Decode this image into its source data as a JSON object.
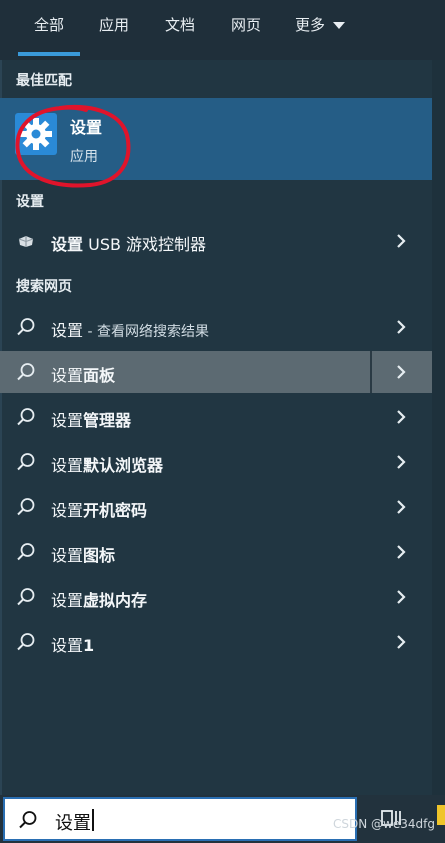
{
  "tabs": [
    {
      "label": "全部",
      "active": true
    },
    {
      "label": "应用",
      "active": false
    },
    {
      "label": "文档",
      "active": false
    },
    {
      "label": "网页",
      "active": false
    },
    {
      "label": "更多",
      "active": false
    }
  ],
  "best_match": {
    "section_label": "最佳匹配",
    "title": "设置",
    "subtitle": "应用",
    "icon": "gear-icon"
  },
  "settings_section": {
    "label": "设置",
    "items": [
      {
        "bold": "设置",
        "rest": " USB 游戏控制器",
        "icon": "gamepad-icon"
      }
    ]
  },
  "web_section": {
    "label": "搜索网页",
    "items": [
      {
        "prefix": "设置",
        "suffix": " - 查看网络搜索结果",
        "style": "muted"
      },
      {
        "prefix": "设置",
        "suffix": "面板",
        "style": "bold",
        "selected": true
      },
      {
        "prefix": "设置",
        "suffix": "管理器",
        "style": "bold"
      },
      {
        "prefix": "设置",
        "suffix": "默认浏览器",
        "style": "bold"
      },
      {
        "prefix": "设置",
        "suffix": "开机密码",
        "style": "bold"
      },
      {
        "prefix": "设置",
        "suffix": "图标",
        "style": "bold"
      },
      {
        "prefix": "设置",
        "suffix": "虚拟内存",
        "style": "bold"
      },
      {
        "prefix": "设置",
        "suffix": "1",
        "style": "bold"
      }
    ]
  },
  "search": {
    "value": "设置"
  },
  "watermark": "CSDN @we34dfg",
  "colors": {
    "accent": "#3a9ad9",
    "selection": "#255d86",
    "annotation": "#e0142b"
  }
}
